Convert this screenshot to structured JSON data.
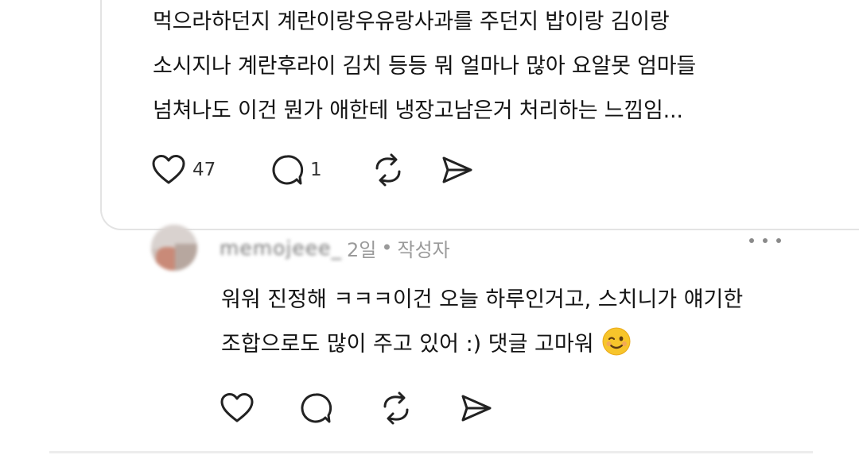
{
  "parent_post": {
    "lines": [
      "먹으라하던지 계란이랑우유랑사과를 주던지 밥이랑 김이랑",
      "소시지나 계란후라이 김치 등등 뭐 얼마나 많아 요알못 엄마들",
      "넘쳐나도 이건 뭔가 애한테 냉장고남은거 처리하는 느낌임..."
    ],
    "like_count": "47",
    "reply_count": "1"
  },
  "reply": {
    "username": "memojeee_",
    "time": "2일",
    "separator": "•",
    "author_badge": "작성자",
    "lines": [
      "워워 진정해 ㅋㅋㅋ이건 오늘 하루인거고, 스치니가 얘기한",
      "조합으로도 많이 주고 있어 :) 댓글 고마워"
    ],
    "emoji": "winking-face"
  },
  "icons": {
    "like": "heart-icon",
    "reply": "comment-icon",
    "repost": "repost-icon",
    "share": "share-send-icon",
    "more": "more-dots-icon"
  },
  "colors": {
    "text": "#141414",
    "muted": "#9a9a9a",
    "icon": "#222222",
    "divider": "#e3e3e3"
  }
}
